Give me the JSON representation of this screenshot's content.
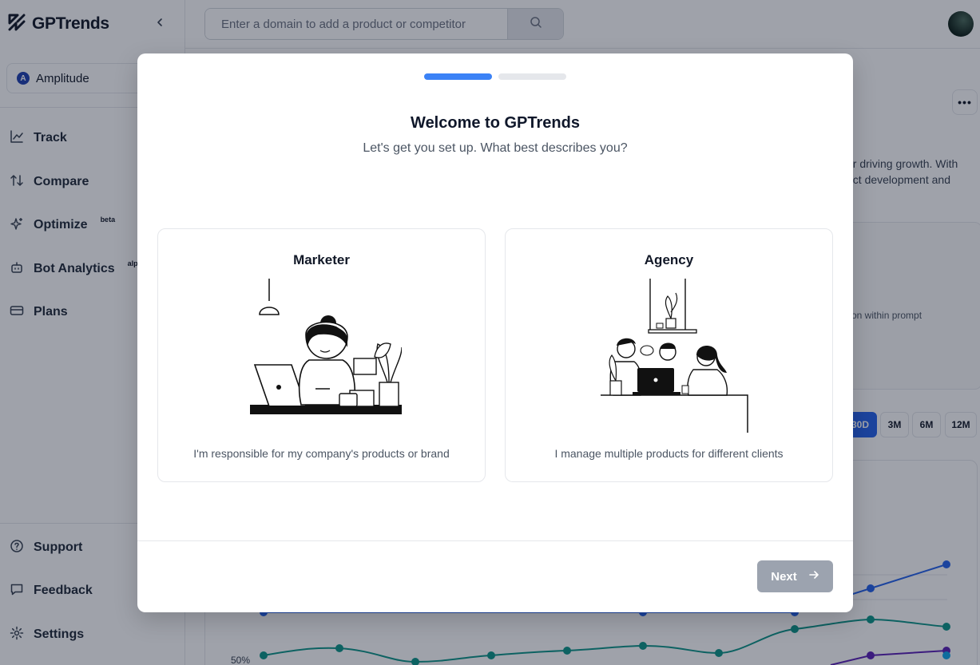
{
  "app": {
    "name": "GPTrends"
  },
  "sidebar": {
    "product": "Amplitude",
    "nav": [
      {
        "label": "Track",
        "icon": "chart-line-icon"
      },
      {
        "label": "Compare",
        "icon": "arrows-up-down-icon"
      },
      {
        "label": "Optimize",
        "badge": "beta",
        "icon": "sparkles-icon"
      },
      {
        "label": "Bot Analytics",
        "badge": "alpha",
        "icon": "bot-icon"
      },
      {
        "label": "Plans",
        "icon": "credit-card-icon"
      }
    ],
    "bottom_nav": [
      {
        "label": "Support",
        "icon": "help-circle-icon"
      },
      {
        "label": "Feedback",
        "icon": "message-icon"
      },
      {
        "label": "Settings",
        "icon": "gear-icon"
      }
    ]
  },
  "search": {
    "placeholder": "Enter a domain to add a product or competitor"
  },
  "background": {
    "description_line1": "or driving growth. With",
    "description_line2": "uct development and",
    "card_text": "on within prompt",
    "ranges": [
      "30D",
      "3M",
      "6M",
      "12M"
    ],
    "active_range": "30D",
    "y_tick": "50%"
  },
  "modal": {
    "step_current": 1,
    "step_total": 2,
    "title": "Welcome to GPTrends",
    "subtitle": "Let's get you set up. What best describes you?",
    "options": [
      {
        "title": "Marketer",
        "description": "I'm responsible for my company's products or brand"
      },
      {
        "title": "Agency",
        "description": "I manage multiple products for different clients"
      }
    ],
    "next_label": "Next"
  },
  "colors": {
    "accent": "#3b82f6",
    "next_disabled": "#9ca3af"
  }
}
